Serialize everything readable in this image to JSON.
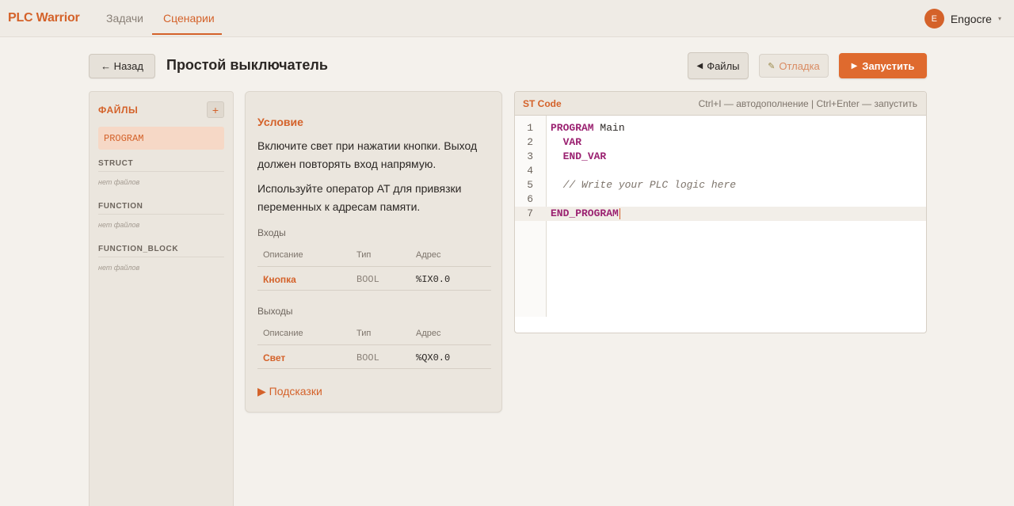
{
  "app": {
    "brand": "PLC Warrior",
    "nav": [
      {
        "label": "Задачи",
        "active": false
      },
      {
        "label": "Сценарии",
        "active": true
      }
    ],
    "user": {
      "initial": "E",
      "name": "Engocre",
      "caret": "▾"
    }
  },
  "header": {
    "back_label": "← Назад",
    "title": "Простой выключатель",
    "files_icon": "◀",
    "files_label": "Файлы",
    "debug_icon": "✎",
    "debug_label": "Отладка",
    "run_icon": "▶",
    "run_label": "Запустить"
  },
  "files": {
    "heading": "ФАЙЛЫ",
    "add_label": "+",
    "program_file": "PROGRAM",
    "sections": [
      {
        "title": "STRUCT",
        "empty": "нет файлов"
      },
      {
        "title": "FUNCTION",
        "empty": "нет файлов"
      },
      {
        "title": "FUNCTION_BLOCK",
        "empty": "нет файлов"
      }
    ]
  },
  "task": {
    "title": "Условие",
    "paragraph1": "Включите свет при нажатии кнопки. Выход должен повторять вход напрямую.",
    "paragraph2": "Используйте оператор AT для привязки переменных к адресам памяти.",
    "inputs": {
      "caption": "Входы",
      "headers": [
        "Описание",
        "Тип",
        "Адрес"
      ],
      "rows": [
        [
          "Кнопка",
          "BOOL",
          "%IX0.0"
        ]
      ]
    },
    "outputs": {
      "caption": "Выходы",
      "headers": [
        "Описание",
        "Тип",
        "Адрес"
      ],
      "rows": [
        [
          "Свет",
          "BOOL",
          "%QX0.0"
        ]
      ]
    },
    "hints_label": "▶ Подсказки"
  },
  "editor": {
    "language": "ST Code",
    "shortcuts": "Ctrl+I — автодополнение | Ctrl+Enter — запустить",
    "lines": [
      {
        "num": "1",
        "kw": "PROGRAM",
        "rest": " Main",
        "indent": "",
        "comment": ""
      },
      {
        "num": "2",
        "kw": "VAR",
        "rest": "",
        "indent": "  ",
        "comment": ""
      },
      {
        "num": "3",
        "kw": "END_VAR",
        "rest": "",
        "indent": "  ",
        "comment": ""
      },
      {
        "num": "4",
        "kw": "",
        "rest": "",
        "indent": "",
        "comment": ""
      },
      {
        "num": "5",
        "kw": "",
        "rest": "",
        "indent": "  ",
        "comment": "// Write your PLC logic here"
      },
      {
        "num": "6",
        "kw": "",
        "rest": "",
        "indent": "",
        "comment": ""
      },
      {
        "num": "7",
        "kw": "END_PROGRAM",
        "rest": "",
        "indent": "",
        "comment": ""
      }
    ],
    "active_line": 7
  },
  "colors": {
    "accent": "#d4622a",
    "run_button": "#df6a2e",
    "keyword": "#9b2271",
    "background": "#f4f1ec"
  }
}
